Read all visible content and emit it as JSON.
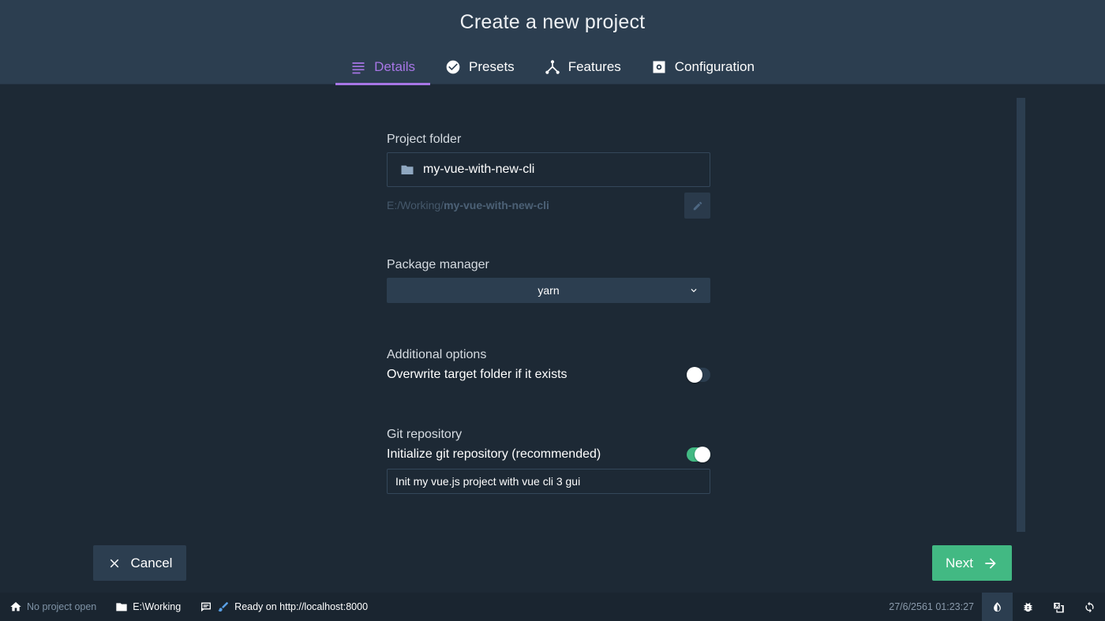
{
  "header": {
    "title": "Create a new project",
    "tabs": [
      {
        "label": "Details",
        "icon": "list-icon",
        "active": true
      },
      {
        "label": "Presets",
        "icon": "check-circle-icon",
        "active": false
      },
      {
        "label": "Features",
        "icon": "fork-icon",
        "active": false
      },
      {
        "label": "Configuration",
        "icon": "gear-icon",
        "active": false
      }
    ]
  },
  "form": {
    "project_folder": {
      "label": "Project folder",
      "value": "my-vue-with-new-cli",
      "path_prefix": "E:/Working/",
      "path_name": "my-vue-with-new-cli"
    },
    "package_manager": {
      "label": "Package manager",
      "selected": "yarn"
    },
    "additional_options": {
      "label": "Additional options",
      "overwrite_label": "Overwrite target folder if it exists",
      "overwrite_enabled": false
    },
    "git": {
      "label": "Git repository",
      "init_label": "Initialize git repository (recommended)",
      "init_enabled": true,
      "commit_message": "Init my vue.js project with vue cli 3 gui"
    }
  },
  "actions": {
    "cancel_label": "Cancel",
    "next_label": "Next"
  },
  "statusbar": {
    "project": "No project open",
    "folder": "E:\\Working",
    "status": "Ready on http://localhost:8000",
    "datetime": "27/6/2561 01:23:27"
  },
  "colors": {
    "background": "#1d2935",
    "header": "#2c3e50",
    "accent": "#a776e6",
    "primary": "#42b983"
  }
}
